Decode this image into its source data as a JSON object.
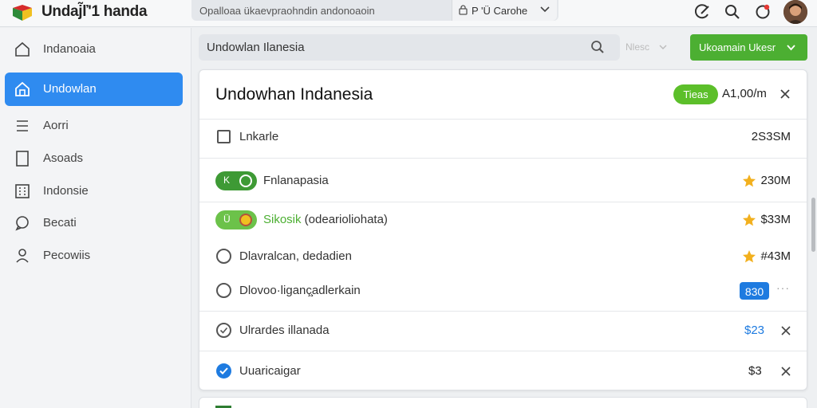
{
  "app": {
    "title": "Undaj̃ľ'1 handa"
  },
  "topbar": {
    "url_text": "Opalloaa ükaevpraohndin andonoaoin",
    "profile_label": "P 'Ü Carohe"
  },
  "sidebar": {
    "items": [
      {
        "label": "Indanoaia",
        "icon": "home-icon",
        "active": false
      },
      {
        "label": "Undowlan",
        "icon": "house-icon",
        "active": true
      },
      {
        "label": "Aorri",
        "icon": "list-icon",
        "active": false
      },
      {
        "label": "Asoads",
        "icon": "document-icon",
        "active": false
      },
      {
        "label": "Indonsie",
        "icon": "grid-icon",
        "active": false
      },
      {
        "label": "Becati",
        "icon": "chat-icon",
        "active": false
      },
      {
        "label": "Pecowiis",
        "icon": "user-icon",
        "active": false
      }
    ]
  },
  "toolbar": {
    "search_text": "Undowlan Ilanesia",
    "filter_label": "Nlesc",
    "primary_button": "Ukoamain Ukesr"
  },
  "panel": {
    "title": "Undowhan Indanesia",
    "status": "Tieas",
    "amount": "A1,00/m",
    "rows": [
      {
        "label": "Lnkarle",
        "value": "2S3SM"
      },
      {
        "label": "Fnlanapasia",
        "toggle_text": "K",
        "value": "230M"
      },
      {
        "label": "Sikosik",
        "label_rest": " (odearioliohata)",
        "toggle_text": "Ü",
        "value": "$33M"
      },
      {
        "label": "Dlavralcan, dedadien",
        "value": "#43M"
      },
      {
        "label": "Dlovoo·liganç̧adlerkain",
        "badge": "830",
        "dots": "···"
      },
      {
        "label": "Ulrardes illanada",
        "value": "$23"
      },
      {
        "label": "Uuaricaigar",
        "value": "$3"
      }
    ]
  },
  "colors": {
    "accent_blue": "#2f8bf0",
    "primary_green": "#4caf32",
    "status_green": "#5cbf2a",
    "badge_blue": "#1e7be0",
    "star_yellow": "#f2b01e"
  }
}
